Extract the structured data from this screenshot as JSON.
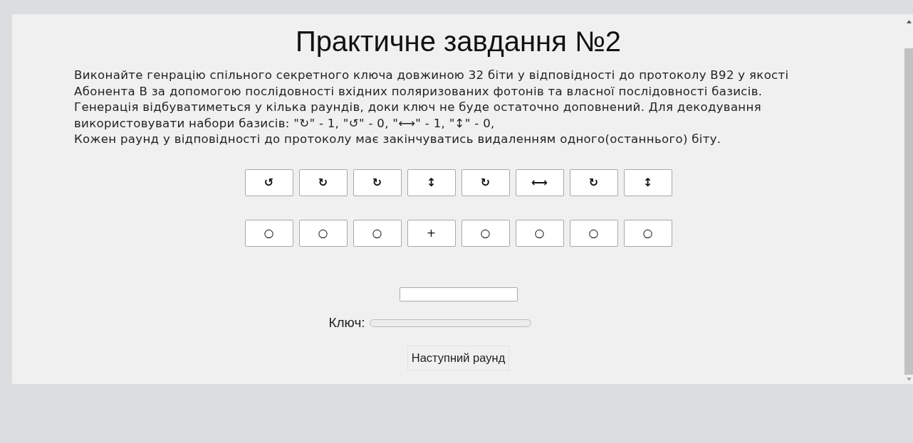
{
  "title": "Практичне завдання №2",
  "paragraphs": [
    "Виконайте генрацію спільного секретного ключа довжиною 32 біти у відповідності до протоколу B92 у якості Абонента B за допомогою послідовності вхідних поляризованих фотонів та власної послідовності базисів. Генерація відбуватиметься у кілька раундів, доки ключ не буде остаточно доповнений. Для декодування використовувати набори базисів: \"↻\" - 1, \"↺\" - 0, \"⟷\" - 1, \"↕\" - 0,",
    "Кожен раунд у відповідності до протоколу має закінчуватись видаленням одного(останнього) біту."
  ],
  "photons": [
    "↺",
    "↻",
    "↻",
    "↕",
    "↻",
    "⟷",
    "↻",
    "↕"
  ],
  "bases": [
    "○",
    "○",
    "○",
    "+",
    "○",
    "○",
    "○",
    "○"
  ],
  "key_label": "Ключ:",
  "key_progress": {
    "level": 0
  },
  "next_button": "Наступний раунд"
}
